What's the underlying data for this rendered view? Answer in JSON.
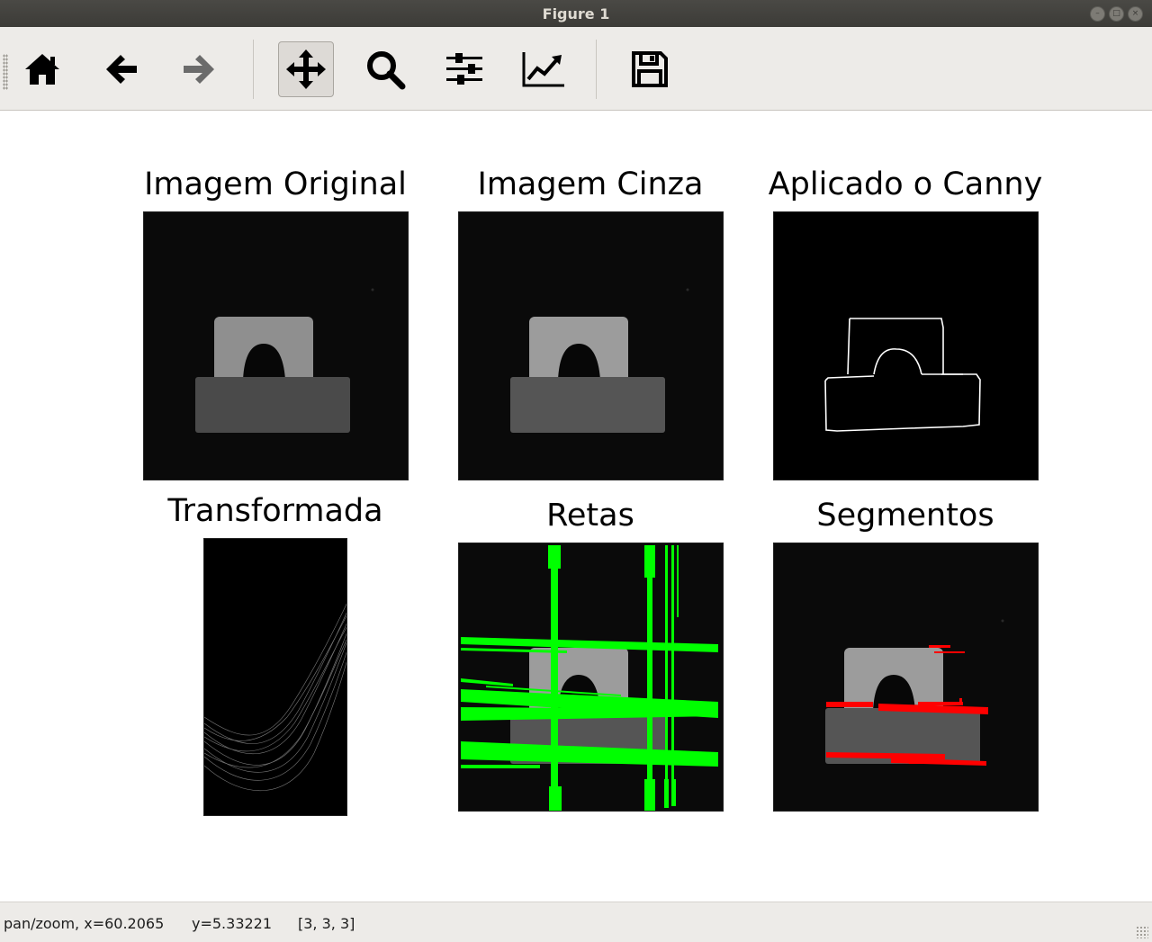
{
  "window": {
    "title": "Figure 1"
  },
  "toolbar": {
    "buttons": [
      {
        "icon": "home-icon"
      },
      {
        "icon": "back-arrow-icon"
      },
      {
        "icon": "forward-arrow-icon"
      },
      {
        "icon": "pan-move-icon",
        "active": true
      },
      {
        "icon": "zoom-magnifier-icon"
      },
      {
        "icon": "subplots-sliders-icon"
      },
      {
        "icon": "edit-curve-chart-icon"
      },
      {
        "icon": "save-floppy-icon"
      }
    ]
  },
  "figure": {
    "panels": [
      {
        "title": "Imagem Original"
      },
      {
        "title": "Imagem Cinza"
      },
      {
        "title": "Aplicado o Canny"
      },
      {
        "title": "Transformada"
      },
      {
        "title": "Retas"
      },
      {
        "title": "Segmentos"
      }
    ]
  },
  "status": {
    "mode": "pan/zoom, x=60.2065",
    "y": "y=5.33221",
    "pixel": "[3, 3, 3]"
  },
  "colors": {
    "lines": "#00ff00",
    "segments": "#ff0000",
    "edges": "#ffffff"
  }
}
